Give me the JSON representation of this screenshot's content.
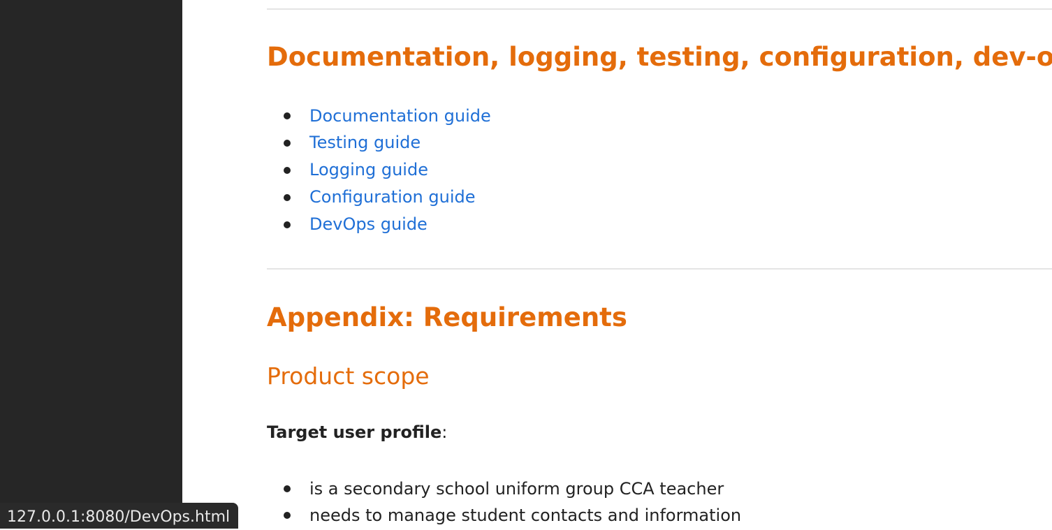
{
  "sections": {
    "devops": {
      "title": "Documentation, logging, testing, configuration, dev-ops",
      "links": [
        "Documentation guide",
        "Testing guide",
        "Logging guide",
        "Configuration guide",
        "DevOps guide"
      ]
    },
    "appendix": {
      "title": "Appendix: Requirements",
      "product_scope": {
        "title": "Product scope",
        "profile_label": "Target user profile",
        "profile_suffix": ":",
        "items": [
          "is a secondary school uniform group CCA teacher",
          "needs to manage student contacts and information"
        ]
      }
    }
  },
  "status_bar": {
    "url": "127.0.0.1:8080/DevOps.html"
  },
  "colors": {
    "heading": "#e46c0b",
    "link": "#1f6fd6",
    "sidebar": "#262626"
  }
}
